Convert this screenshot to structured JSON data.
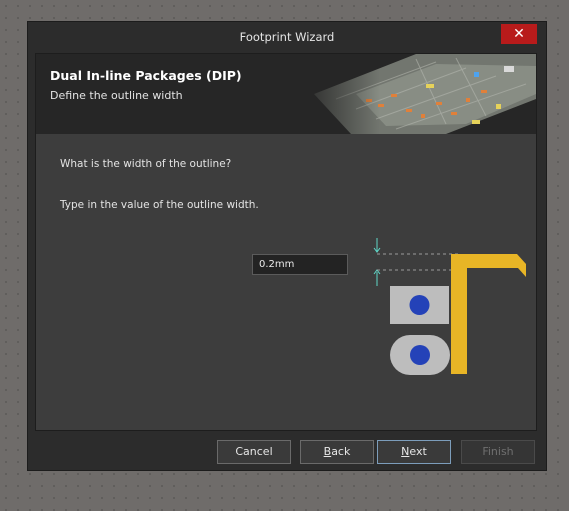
{
  "window": {
    "title": "Footprint Wizard",
    "close_glyph": "✕"
  },
  "header": {
    "title": "Dual In-line Packages (DIP)",
    "subtitle": "Define the outline width"
  },
  "content": {
    "question": "What is the width of the outline?",
    "instruction": "Type in the value of the outline width.",
    "outline_width_value": "0.2mm"
  },
  "buttons": {
    "cancel": "Cancel",
    "back_mnemonic": "B",
    "back_rest": "ack",
    "next_mnemonic": "N",
    "next_rest": "ext",
    "finish": "Finish"
  },
  "icons": {
    "close": "close-icon"
  },
  "colors": {
    "outline_yellow": "#e8b526",
    "pad_gray": "#bdbdbd",
    "hole_blue": "#2442b8",
    "dimension_teal": "#5fd7c8",
    "close_red": "#b81b1b"
  }
}
